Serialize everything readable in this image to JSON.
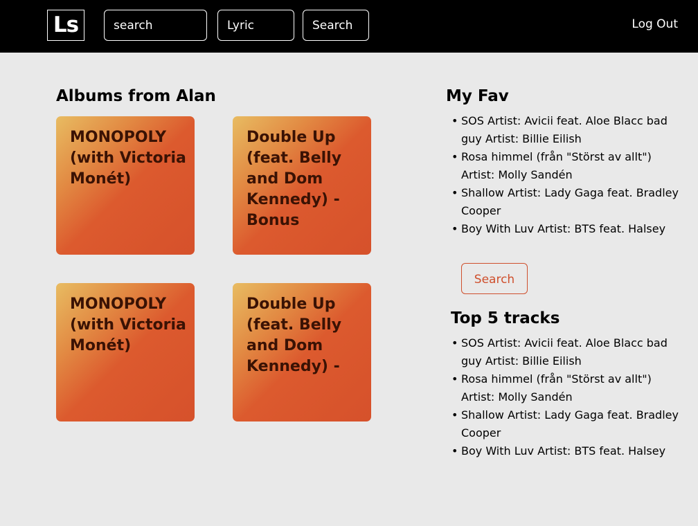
{
  "header": {
    "logo": "Ls",
    "search_input_value": "search",
    "filter_select_value": "Lyric",
    "search_button_label": "Search",
    "logout_label": "Log Out"
  },
  "albums": {
    "title": "Albums from Alan",
    "items": [
      "MONOPOLY (with Victoria Monét)",
      "Double Up (feat. Belly and Dom Kennedy) - Bonus",
      "MONOPOLY (with Victoria Monét)",
      "Double Up (feat. Belly and Dom Kennedy) -"
    ]
  },
  "favorites": {
    "title": "My Fav",
    "items": [
      "SOS Artist: Avicii feat. Aloe Blacc bad guy Artist: Billie Eilish",
      "Rosa himmel (från \"Störst av allt\") Artist: Molly Sandén",
      "Shallow Artist: Lady Gaga feat. Bradley Cooper",
      "Boy With Luv Artist: BTS feat. Halsey"
    ],
    "search_button_label": "Search"
  },
  "top_tracks": {
    "title": "Top 5 tracks",
    "items": [
      "SOS Artist: Avicii feat. Aloe Blacc bad guy Artist: Billie Eilish",
      "Rosa himmel (från \"Störst av allt\") Artist: Molly Sandén",
      "Shallow Artist: Lady Gaga feat. Bradley Cooper",
      "Boy With Luv Artist: BTS feat. Halsey"
    ]
  },
  "colors": {
    "topbar": "#000000",
    "background": "#e9e9e9",
    "accent": "#cf4f2c",
    "card_gradient_start": "#e8bc62",
    "card_gradient_end": "#d6512b",
    "card_text": "#3a1204"
  }
}
